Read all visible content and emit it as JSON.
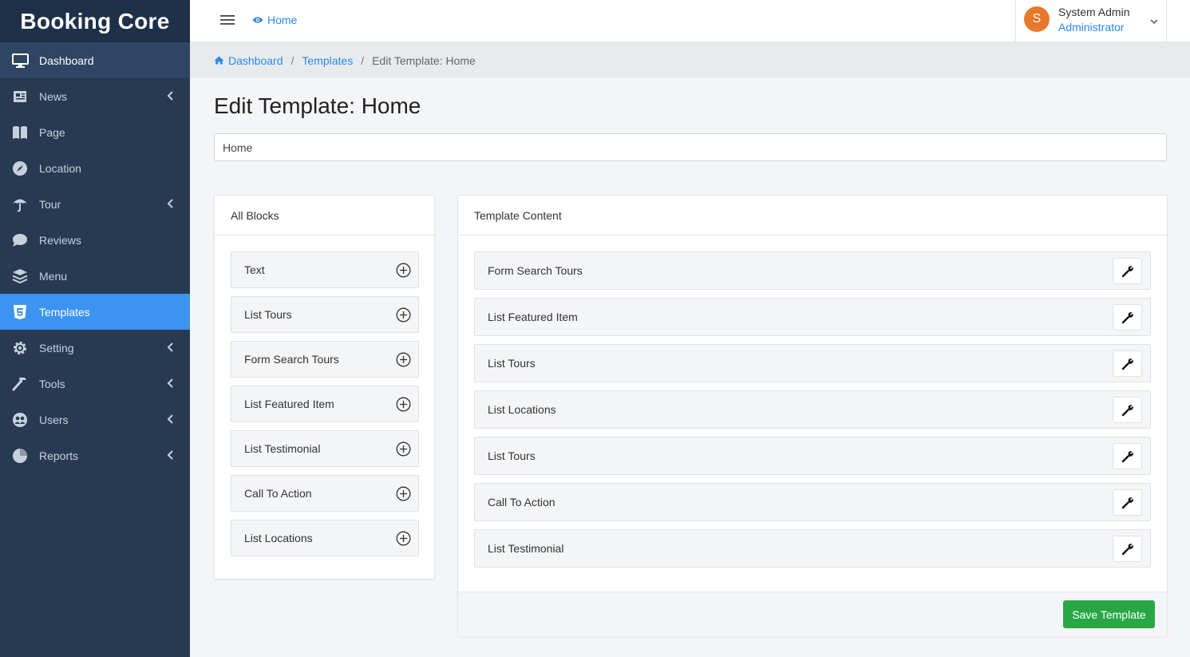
{
  "brand": "Booking Core",
  "sidebar": {
    "items": [
      {
        "label": "Dashboard",
        "icon": "monitor-icon"
      },
      {
        "label": "News",
        "icon": "newspaper-icon"
      },
      {
        "label": "Page",
        "icon": "book-icon"
      },
      {
        "label": "Location",
        "icon": "compass-icon"
      },
      {
        "label": "Tour",
        "icon": "umbrella-icon"
      },
      {
        "label": "Reviews",
        "icon": "comment-icon"
      },
      {
        "label": "Menu",
        "icon": "layers-icon"
      },
      {
        "label": "Templates",
        "icon": "html5-icon"
      },
      {
        "label": "Setting",
        "icon": "gear-icon"
      },
      {
        "label": "Tools",
        "icon": "hammer-icon"
      },
      {
        "label": "Users",
        "icon": "users-icon"
      },
      {
        "label": "Reports",
        "icon": "pie-chart-icon"
      }
    ]
  },
  "header": {
    "home_label": "Home",
    "user": {
      "initial": "S",
      "name": "System Admin",
      "role": "Administrator"
    }
  },
  "breadcrumb": {
    "dashboard": "Dashboard",
    "templates": "Templates",
    "current": "Edit Template: Home"
  },
  "page": {
    "title": "Edit Template: Home",
    "name_value": "Home"
  },
  "blocks_panel": {
    "title": "All Blocks",
    "items": [
      "Text",
      "List Tours",
      "Form Search Tours",
      "List Featured Item",
      "List Testimonial",
      "Call To Action",
      "List Locations"
    ]
  },
  "content_panel": {
    "title": "Template Content",
    "items": [
      "Form Search Tours",
      "List Featured Item",
      "List Tours",
      "List Locations",
      "List Tours",
      "Call To Action",
      "List Testimonial"
    ],
    "save_label": "Save Template"
  },
  "colors": {
    "sidebar_bg": "#283a52",
    "active_item": "#3c93f0",
    "link": "#2d89e5",
    "save_button": "#28a745",
    "avatar": "#e8782b"
  }
}
